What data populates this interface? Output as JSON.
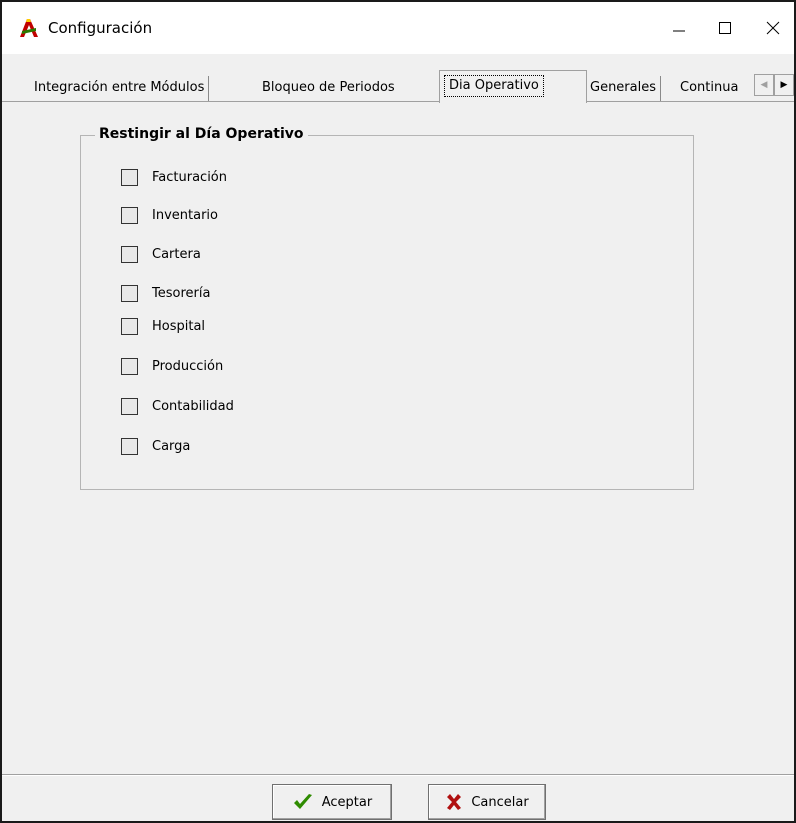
{
  "window": {
    "title": "Configuración",
    "controls": {
      "minimize_icon": "minimize-icon",
      "maximize_icon": "maximize-icon",
      "close_icon": "close-icon"
    }
  },
  "tabs": [
    {
      "label": "Integración entre Módulos",
      "active": false
    },
    {
      "label": "Bloqueo de Periodos",
      "active": false
    },
    {
      "label": "Dia Operativo",
      "active": true
    },
    {
      "label": "Generales",
      "active": false
    },
    {
      "label": "Continua",
      "active": false
    }
  ],
  "group": {
    "title": "Restingir al Día Operativo",
    "items": [
      {
        "label": "Facturación",
        "checked": false
      },
      {
        "label": "Inventario",
        "checked": false
      },
      {
        "label": "Cartera",
        "checked": false
      },
      {
        "label": "Tesorería",
        "checked": false
      },
      {
        "label": "Hospital",
        "checked": false
      },
      {
        "label": "Producción",
        "checked": false
      },
      {
        "label": "Contabilidad",
        "checked": false
      },
      {
        "label": "Carga",
        "checked": false
      }
    ]
  },
  "buttons": {
    "accept_label": "Aceptar",
    "cancel_label": "Cancelar"
  },
  "colors": {
    "accept_check": "#2e8b00",
    "cancel_x": "#b01010",
    "window_bg": "#f0f0f0"
  }
}
